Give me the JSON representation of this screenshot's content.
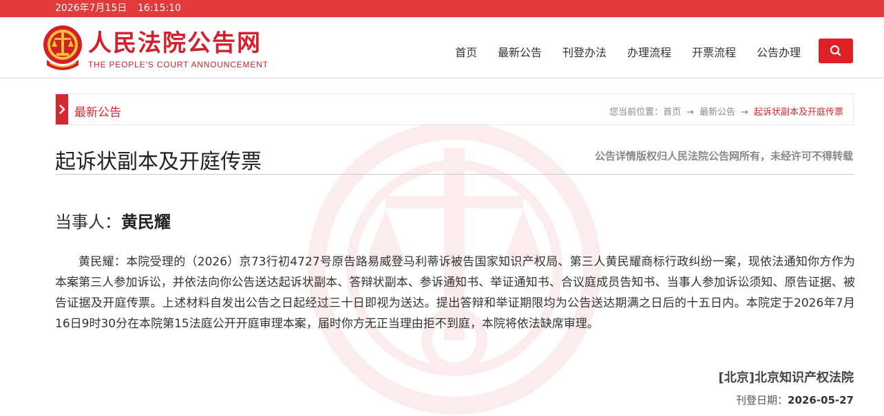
{
  "topbar": {
    "date": "2026年7月15日",
    "time": "16:15:10"
  },
  "brand": {
    "name_cn": "人民法院公告网",
    "name_en": "THE PEOPLE’S COURT ANNOUNCEMENT",
    "color": "#d3202b"
  },
  "nav": {
    "items": [
      "首页",
      "最新公告",
      "刊登办法",
      "办理流程",
      "开票流程",
      "公告办理"
    ],
    "search_icon": "search-icon"
  },
  "breadcrumb": {
    "section": "最新公告",
    "prefix": "您当前位置：",
    "home": "首页",
    "arrow": "→",
    "level1": "最新公告",
    "current": "起诉状副本及开庭传票"
  },
  "article": {
    "title": "起诉状副本及开庭传票",
    "copyright": "公告详情版权归人民法院公告网所有，未经许可不得转载",
    "party_label": "当事人：",
    "party_name": "黄民耀",
    "body": "黄民耀：本院受理的（2026）京73行初4727号原告路易威登马利蒂诉被告国家知识产权局、第三人黄民耀商标行政纠纷一案，现依法通知你方作为本案第三人参加诉讼，并依法向你公告送达起诉状副本、答辩状副本、参诉通知书、举证通知书、合议庭成员告知书、当事人参加诉讼须知、原告证据、被告证据及开庭传票。上述材料自发出公告之日起经过三十日即视为送达。提出答辩和举证期限均为公告送达期满之日后的十五日内。本院定于2026年7月16日9时30分在本院第15法庭公开开庭审理本案，届时你方无正当理由拒不到庭，本院将依法缺席审理。",
    "court": "[北京]北京知识产权法院",
    "date_label": "刊登日期：",
    "date": "2026-05-27"
  },
  "colors": {
    "accent": "#e23a3a",
    "brand_red": "#d42a2f"
  }
}
